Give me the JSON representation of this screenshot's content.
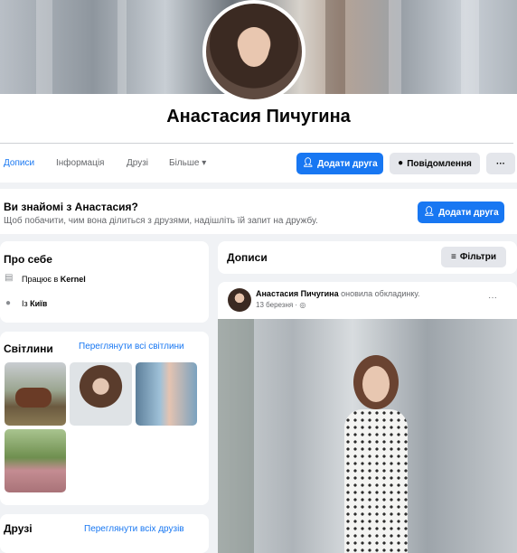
{
  "profile": {
    "name": "Анастасия Пичугина"
  },
  "nav": {
    "tabs": [
      {
        "label": "Дописи",
        "active": true
      },
      {
        "label": "Інформація",
        "active": false
      },
      {
        "label": "Друзі",
        "active": false
      },
      {
        "label": "Більше ▾",
        "active": false
      }
    ],
    "add_friend_label": "Додати друга",
    "message_label": "Повідомлення",
    "more_label": "···"
  },
  "know_box": {
    "title": "Ви знайомі з Анастасия?",
    "subtitle": "Щоб побачити, чим вона ділиться з друзями, надішліть їй запит на дружбу.",
    "button_label": "Додати друга"
  },
  "about": {
    "title": "Про себе",
    "work_prefix": "Працює в ",
    "work_place": "Kernel",
    "city_prefix": "Із ",
    "city": "Київ"
  },
  "photos": {
    "title": "Світлини",
    "link": "Переглянути всі світлини"
  },
  "friends": {
    "title": "Друзі",
    "link": "Переглянути всіх друзів"
  },
  "posts": {
    "title": "Дописи",
    "filter_label": "Фільтри",
    "post": {
      "author": "Анастасия Пичугина",
      "action": " оновила обкладинку.",
      "date": "13 березня · ",
      "more_label": "···"
    }
  },
  "colors": {
    "accent": "#1877f2",
    "background": "#f0f2f5",
    "secondary_text": "#65676b"
  },
  "icons": {
    "add_friend": "person-plus-icon",
    "message": "messenger-icon",
    "work": "briefcase-icon",
    "city": "location-pin-icon",
    "filter": "sliders-icon",
    "privacy": "globe-icon"
  }
}
